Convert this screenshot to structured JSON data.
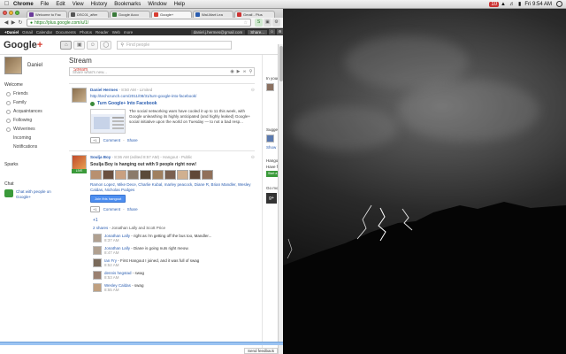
{
  "menubar": {
    "app": "Chrome",
    "items": [
      "File",
      "Edit",
      "View",
      "History",
      "Bookmarks",
      "Window",
      "Help"
    ],
    "badge": "10",
    "clock": "Fri 9:54 AM"
  },
  "browser": {
    "tabs": [
      {
        "label": "Welcome to Fac",
        "color": "#6a3a9a"
      },
      {
        "label": "DSC01_after",
        "color": "#555555"
      },
      {
        "label": "Google Acco",
        "color": "#3a7a3a"
      },
      {
        "label": "Google+",
        "color": "#d73d32"
      },
      {
        "label": "Wal-Mart Lea",
        "color": "#2a5db0"
      },
      {
        "label": "Gmail - Plus",
        "color": "#c33"
      }
    ],
    "url": "https://plus.google.com/u/1/"
  },
  "gbar": {
    "items": [
      "+Daniel",
      "Gmail",
      "Calendar",
      "Documents",
      "Photos",
      "Reader",
      "Web",
      "more"
    ],
    "email": "daniel.j.hermes@gmail.com",
    "share": "Share..."
  },
  "header": {
    "logo_text": "Google",
    "logo_plus": "+",
    "search_placeholder": "Find people"
  },
  "leftnav": {
    "name": "Daniel",
    "welcome": "Welcome",
    "stream": "Stream",
    "circles": [
      "Friends",
      "Family",
      "Acquaintances",
      "Following",
      "Wolverines",
      "Incoming",
      "Notifications"
    ],
    "sparks": "Sparks",
    "chat": "Chat",
    "chat_text": "Chat with people on Google+"
  },
  "stream": {
    "title": "Stream",
    "share_placeholder": "Share what's new...",
    "post1": {
      "author": "Daniel Hermes",
      "meta": " - 8:50 AM  -  Limited",
      "url": "http://techcrunch.com/2011/08/31/turn-google-into-facebook/",
      "link_title": "Turn Google+ Into Facebook",
      "link_text": "The social networking wars have cooled it up to 11 this week, with Google unleashing its highly anticipated (and highly leaked) Google+ social initiative upon the world on Tuesday — to not a bad resp...",
      "plus1": "+1",
      "comment": "Comment",
      "share": "Share"
    },
    "post2": {
      "author": "Soulja Boy",
      "meta": " - 8:36 AM (edited 8:57 AM)  -  Hangout  -  Public",
      "live": "LIVE",
      "hangout_title": "Soulja Boy is hanging out with 9 people right now!",
      "participants": "Ramon Lopez, Mike Dece, Charlie Kubal, marley peacock, Diane R, Brian Mandler, Wesley Caldas, Nicholas Podges",
      "join": "Join this hangout",
      "plus1": "+1",
      "comment": "Comment",
      "share": "Share",
      "plus1_count": "+1",
      "shares_count": "2 shares",
      "shares_rest": " - Jonathan Lally and Scott Price",
      "comments": [
        {
          "who": "Jonathan Lally",
          "text": " - right as i'm getting off the bus too, Mandler...",
          "when": "8:37 AM"
        },
        {
          "who": "Jonathan Lally",
          "text": " - Diane is going nuts right meow.",
          "when": "8:47 AM"
        },
        {
          "who": "Ian Fry",
          "text": " - First Hangout I joined, and it was full of swag",
          "when": "8:52 AM"
        },
        {
          "who": "dennis hegstad",
          "text": " - swag",
          "when": "8:53 AM"
        },
        {
          "who": "Wesley Caldas",
          "text": " - swag",
          "when": "8:55 AM"
        }
      ]
    }
  },
  "rightcol": {
    "in_your": "In your",
    "suggest": "Sugges",
    "show": "Show",
    "hangout": "Hangout",
    "have": "Have fu",
    "start": "Start a",
    "go_mobile": "Go mob",
    "badge": "g+"
  },
  "footer": {
    "feedback": "Send feedback"
  }
}
